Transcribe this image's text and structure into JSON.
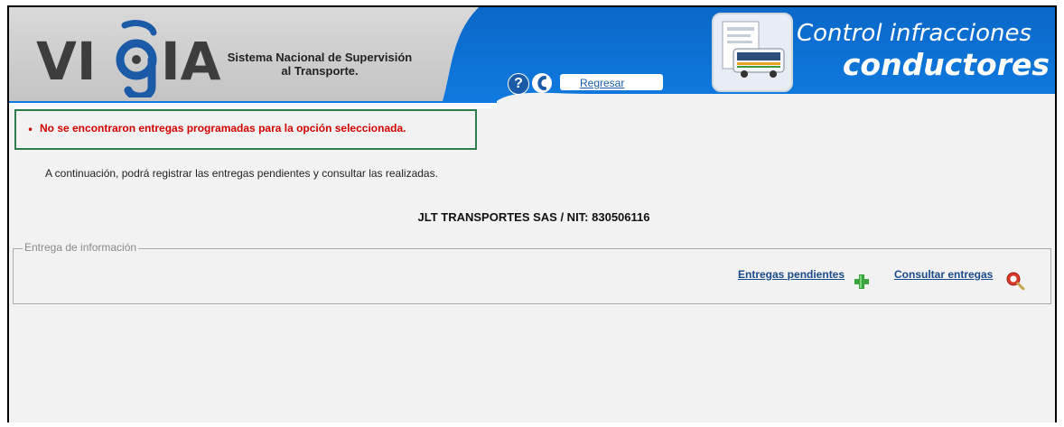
{
  "header": {
    "logo_text": "VI",
    "logo_tail": "IA",
    "subtitle_line1": "Sistema Nacional de Supervisión",
    "subtitle_line2": "al Transporte.",
    "help_label": "?",
    "back_label": "Regresar",
    "title_line1": "Control infracciones",
    "title_line2": "conductores"
  },
  "alert": {
    "message": "No se encontraron entregas programadas para la opción seleccionada."
  },
  "main": {
    "intro": "A continuación, podrá registrar las entregas pendientes y consultar las realizadas.",
    "company": "JLT TRANSPORTES SAS / NIT: 830506116"
  },
  "section": {
    "legend": "Entrega de información",
    "pending_label": "Entregas pendientes",
    "consult_label": "Consultar entregas"
  },
  "colors": {
    "header_blue": "#0b6fd1",
    "logo_gray": "#d0d0d0",
    "alert_border": "#2e7d4a",
    "alert_text": "#d20000",
    "link": "#1a4a8a"
  }
}
